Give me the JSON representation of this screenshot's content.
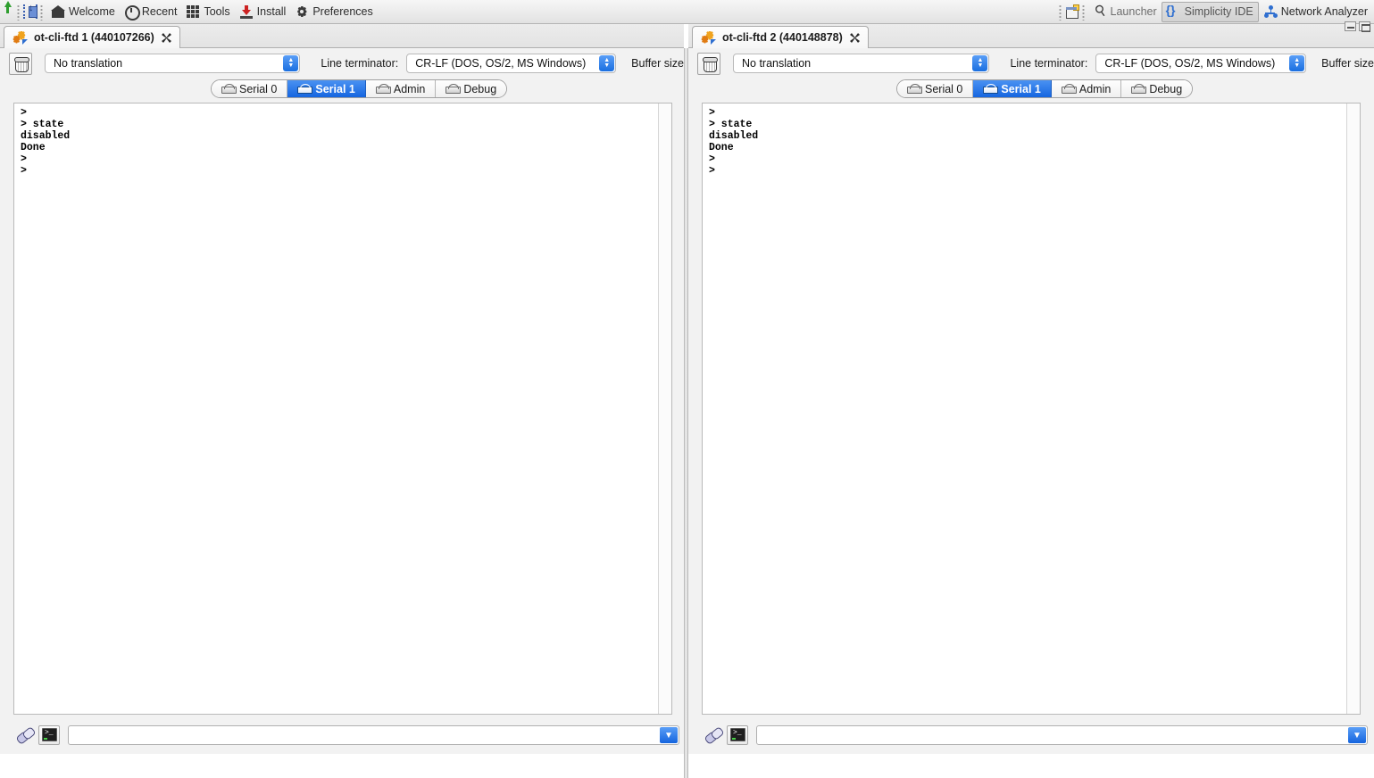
{
  "toolbar": {
    "left_items": [
      {
        "label": "Welcome",
        "icon": "home-icon"
      },
      {
        "label": "Recent",
        "icon": "clock-icon"
      },
      {
        "label": "Tools",
        "icon": "grid-icon"
      },
      {
        "label": "Install",
        "icon": "download-icon"
      },
      {
        "label": "Preferences",
        "icon": "gear-icon"
      }
    ],
    "right_items": [
      {
        "label": "Launcher",
        "icon": "rocket-icon",
        "active": false
      },
      {
        "label": "Simplicity IDE",
        "icon": "braces-icon",
        "active": true
      },
      {
        "label": "Network Analyzer",
        "icon": "network-icon",
        "active": false
      }
    ],
    "perspective_icon": "open-perspective-icon",
    "flash_icon": "flash-programmer-icon",
    "accent_blue": "#1565e0"
  },
  "window_controls": {
    "minimize": "minimize-button",
    "maximize": "maximize-button"
  },
  "panels": [
    {
      "tab_title": "ot-cli-ftd 1 (440107266)",
      "translation": {
        "value": "No translation",
        "label": ""
      },
      "line_terminator": {
        "label": "Line terminator:",
        "value": "CR-LF  (DOS, OS/2, MS Windows)"
      },
      "buffer_size_label": "Buffer size",
      "serial_tabs": [
        {
          "label": "Serial 0",
          "active": false
        },
        {
          "label": "Serial 1",
          "active": true
        },
        {
          "label": "Admin",
          "active": false
        },
        {
          "label": "Debug",
          "active": false
        }
      ],
      "terminal_text": ">\n> state\ndisabled\nDone\n>\n>",
      "command_input": {
        "value": "",
        "placeholder": ""
      }
    },
    {
      "tab_title": "ot-cli-ftd 2 (440148878)",
      "translation": {
        "value": "No translation",
        "label": ""
      },
      "line_terminator": {
        "label": "Line terminator:",
        "value": "CR-LF  (DOS, OS/2, MS Windows)"
      },
      "buffer_size_label": "Buffer size",
      "serial_tabs": [
        {
          "label": "Serial 0",
          "active": false
        },
        {
          "label": "Serial 1",
          "active": true
        },
        {
          "label": "Admin",
          "active": false
        },
        {
          "label": "Debug",
          "active": false
        }
      ],
      "terminal_text": ">\n> state\ndisabled\nDone\n>\n>",
      "command_input": {
        "value": "",
        "placeholder": ""
      }
    }
  ]
}
